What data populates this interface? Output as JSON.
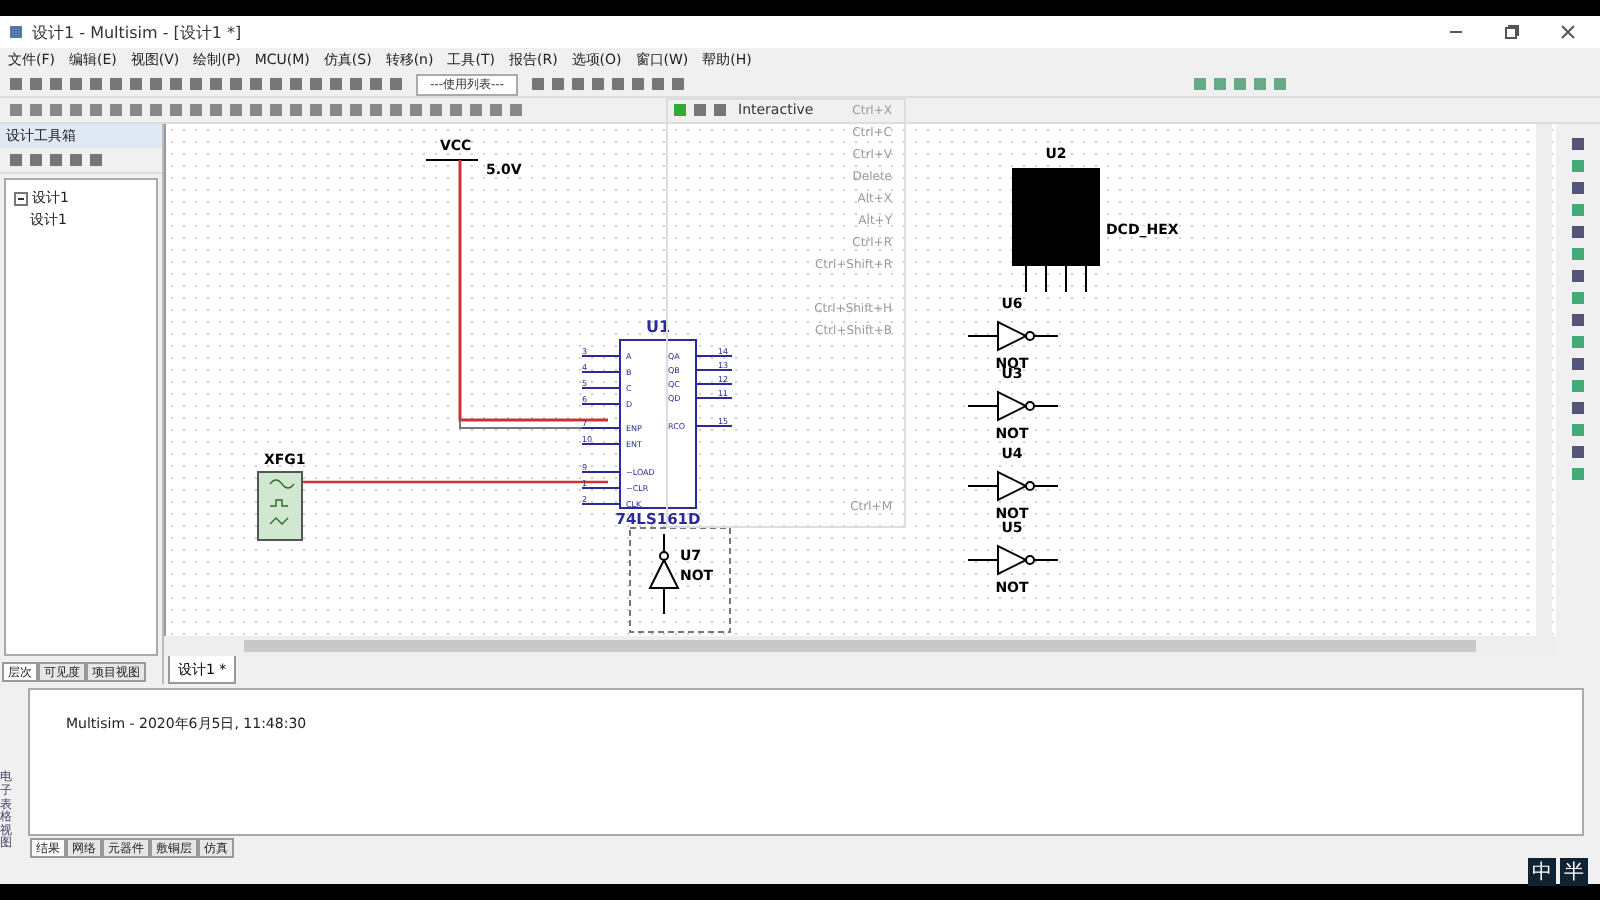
{
  "window": {
    "title": "设计1 - Multisim - [设计1 *]"
  },
  "menu_bar": [
    "文件(F)",
    "编辑(E)",
    "视图(V)",
    "绘制(P)",
    "MCU(M)",
    "仿真(S)",
    "转移(n)",
    "工具(T)",
    "报告(R)",
    "选项(O)",
    "窗口(W)",
    "帮助(H)"
  ],
  "toolbar": {
    "list_dropdown": "---使用列表---",
    "mode": "Interactive"
  },
  "design_toolbox": {
    "title": "设计工具箱",
    "tree": [
      {
        "label": "设计1",
        "expanded": true,
        "children": [
          {
            "label": "设计1"
          }
        ]
      }
    ],
    "tabs": [
      {
        "label": "层次",
        "selected": true
      },
      {
        "label": "可见度",
        "selected": false
      },
      {
        "label": "项目视图",
        "selected": false
      }
    ]
  },
  "schematic": {
    "vcc": {
      "name": "VCC",
      "value": "5.0V"
    },
    "counter": {
      "ref": "U1",
      "part": "74LS161D",
      "left_pins": [
        {
          "num": "3",
          "name": "A"
        },
        {
          "num": "4",
          "name": "B"
        },
        {
          "num": "5",
          "name": "C"
        },
        {
          "num": "6",
          "name": "D"
        },
        {
          "num": "7",
          "name": "ENP"
        },
        {
          "num": "10",
          "name": "ENT"
        },
        {
          "num": "9",
          "name": "~LOAD"
        },
        {
          "num": "1",
          "name": "~CLR"
        },
        {
          "num": "2",
          "name": "CLK"
        }
      ],
      "right_pins": [
        {
          "num": "14",
          "name": "QA"
        },
        {
          "num": "13",
          "name": "QB"
        },
        {
          "num": "12",
          "name": "QC"
        },
        {
          "num": "11",
          "name": "QD"
        },
        {
          "num": "15",
          "name": "RCO"
        }
      ]
    },
    "generator": {
      "ref": "XFG1"
    },
    "display": {
      "ref": "U2",
      "part": "DCD_HEX"
    },
    "inverters": [
      {
        "ref": "U7",
        "part": "NOT",
        "kind": "vertical"
      },
      {
        "ref": "U6",
        "part": "NOT",
        "kind": "row"
      },
      {
        "ref": "U3",
        "part": "NOT",
        "kind": "row"
      },
      {
        "ref": "U4",
        "part": "NOT",
        "kind": "row"
      },
      {
        "ref": "U5",
        "part": "NOT",
        "kind": "row"
      }
    ]
  },
  "context_menu": [
    {
      "kind": "item",
      "shortcut": "Ctrl+X"
    },
    {
      "kind": "item",
      "shortcut": "Ctrl+C"
    },
    {
      "kind": "item",
      "shortcut": "Ctrl+V"
    },
    {
      "kind": "item",
      "shortcut": "Delete"
    },
    {
      "kind": "item",
      "shortcut": "Alt+X"
    },
    {
      "kind": "item",
      "shortcut": "Alt+Y"
    },
    {
      "kind": "item",
      "shortcut": "Ctrl+R"
    },
    {
      "kind": "item",
      "shortcut": "Ctrl+Shift+R"
    },
    {
      "kind": "blank"
    },
    {
      "kind": "item",
      "shortcut": "Ctrl+Shift+H"
    },
    {
      "kind": "item",
      "shortcut": "Ctrl+Shift+B"
    },
    {
      "kind": "blank"
    },
    {
      "kind": "blank"
    },
    {
      "kind": "blank"
    },
    {
      "kind": "blank"
    },
    {
      "kind": "blank"
    },
    {
      "kind": "blank"
    },
    {
      "kind": "blank"
    },
    {
      "kind": "item",
      "shortcut": "Ctrl+M"
    }
  ],
  "document_tabs": [
    {
      "label": "设计1 *",
      "selected": true
    }
  ],
  "output": {
    "side_label": "电子表格视图",
    "log": "Multisim  -  2020年6月5日, 11:48:30",
    "tabs": [
      {
        "label": "结果",
        "selected": true
      },
      {
        "label": "网络",
        "selected": false
      },
      {
        "label": "元器件",
        "selected": false
      },
      {
        "label": "敷铜层",
        "selected": false
      },
      {
        "label": "仿真",
        "selected": false
      }
    ]
  },
  "ime": {
    "language": "中",
    "width": "半"
  }
}
